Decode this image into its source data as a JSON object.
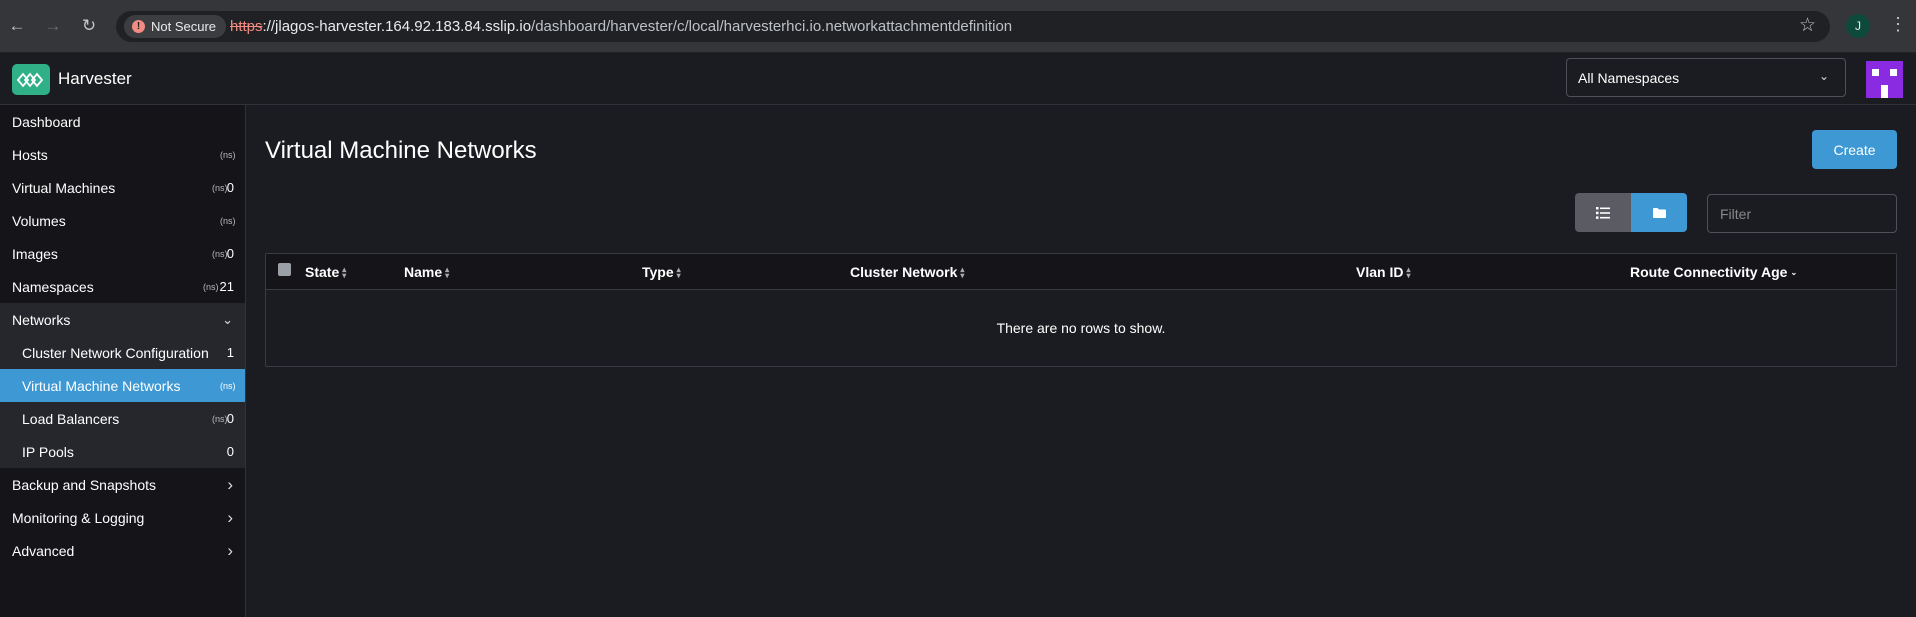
{
  "browser": {
    "not_secure_label": "Not Secure",
    "url_scheme": "https",
    "url_host": "://jlagos-harvester.164.92.183.84.sslip.io",
    "url_path": "/dashboard/harvester/c/local/harvesterhci.io.networkattachmentdefinition",
    "profile_initial": "J"
  },
  "header": {
    "app_name": "Harvester",
    "namespace_selected": "All Namespaces"
  },
  "sidebar": {
    "items": [
      {
        "label": "Dashboard",
        "ns_icon": "",
        "count": "",
        "arrow": ""
      },
      {
        "label": "Hosts",
        "ns_icon": "(ns)",
        "count": "",
        "arrow": ""
      },
      {
        "label": "Virtual Machines",
        "ns_icon": "(ns)",
        "count": "0",
        "arrow": ""
      },
      {
        "label": "Volumes",
        "ns_icon": "(ns)",
        "count": "",
        "arrow": ""
      },
      {
        "label": "Images",
        "ns_icon": "(ns)",
        "count": "0",
        "arrow": ""
      },
      {
        "label": "Namespaces",
        "ns_icon": "(ns)",
        "count": "21",
        "arrow": ""
      },
      {
        "label": "Networks",
        "ns_icon": "",
        "count": "",
        "arrow": "⌄"
      },
      {
        "label": "Cluster Network Configuration",
        "ns_icon": "",
        "count": "1",
        "arrow": ""
      },
      {
        "label": "Virtual Machine Networks",
        "ns_icon": "(ns)",
        "count": "",
        "arrow": ""
      },
      {
        "label": "Load Balancers",
        "ns_icon": "(ns)",
        "count": "0",
        "arrow": ""
      },
      {
        "label": "IP Pools",
        "ns_icon": "",
        "count": "0",
        "arrow": ""
      },
      {
        "label": "Backup and Snapshots",
        "ns_icon": "",
        "count": "",
        "arrow": "›"
      },
      {
        "label": "Monitoring & Logging",
        "ns_icon": "",
        "count": "",
        "arrow": "›"
      },
      {
        "label": "Advanced",
        "ns_icon": "",
        "count": "",
        "arrow": "›"
      }
    ]
  },
  "main": {
    "title": "Virtual Machine Networks",
    "create_label": "Create",
    "filter_placeholder": "Filter",
    "columns": [
      "State",
      "Name",
      "Type",
      "Cluster Network",
      "Vlan ID",
      "Route Connectivity",
      "Age"
    ],
    "empty_message": "There are no rows to show."
  },
  "colors": {
    "accent": "#3d98d3",
    "brand": "#2fb087",
    "avatar": "#8a2be2"
  }
}
